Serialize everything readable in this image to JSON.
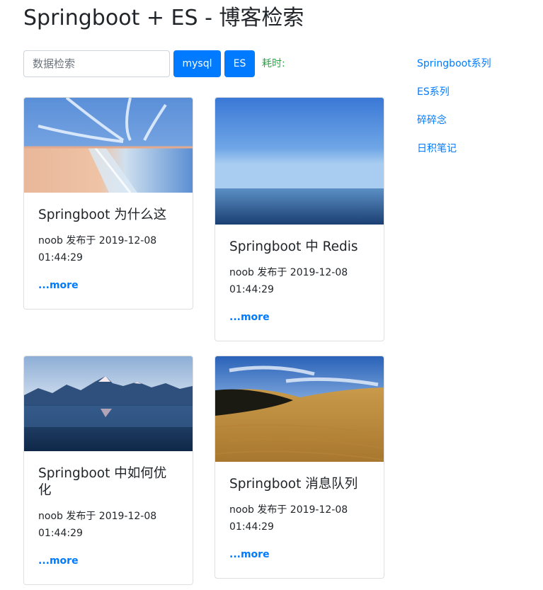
{
  "page": {
    "title": "Springboot + ES - 博客检索"
  },
  "search": {
    "placeholder": "数据检索",
    "value": "",
    "mysql_label": "mysql",
    "es_label": "ES",
    "elapsed_label": "耗时:"
  },
  "sidebar": {
    "links": [
      {
        "label": "Springboot系列"
      },
      {
        "label": "ES系列"
      },
      {
        "label": "碎碎念"
      },
      {
        "label": "日积笔记"
      }
    ]
  },
  "colors": {
    "primary": "#007bff",
    "elapsed": "#28a745",
    "text": "#212529"
  },
  "cards": [
    {
      "title": "Springboot 为什么这",
      "author": "noob",
      "published_label": "发布于",
      "date": "2019-12-08",
      "time": "01:44:29",
      "more": "...more",
      "image": "beach-painting"
    },
    {
      "title": "Springboot 中 Redis",
      "author": "noob",
      "published_label": "发布于",
      "date": "2019-12-08",
      "time": "01:44:29",
      "more": "...more",
      "image": "ocean-horizon"
    },
    {
      "title": "Springboot 中如何优化",
      "author": "noob",
      "published_label": "发布于",
      "date": "2019-12-08",
      "time": "01:44:29",
      "more": "...more",
      "image": "mountain-lake"
    },
    {
      "title": "Springboot 消息队列",
      "author": "noob",
      "published_label": "发布于",
      "date": "2019-12-08",
      "time": "01:44:29",
      "more": "...more",
      "image": "desert-dunes"
    }
  ]
}
